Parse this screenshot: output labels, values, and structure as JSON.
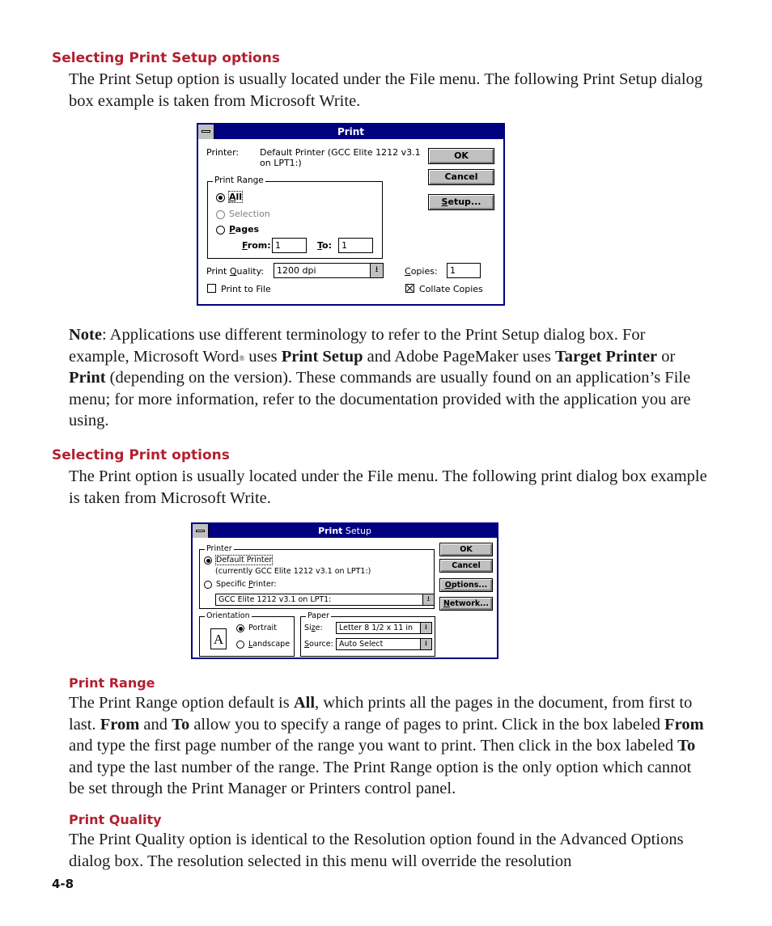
{
  "sections": {
    "print_setup_heading": "Selecting Print Setup options",
    "print_setup_intro": "The Print Setup option is usually located under the File menu. The following Print Setup dialog box example is taken from Microsoft Write.",
    "note": {
      "label": "Note",
      "text_1": ": Applications use different terminology to refer to the Print Setup dialog box. For example, Microsoft Word",
      "reg": "®",
      "text_2": " uses ",
      "bold_1": "Print Setup",
      "text_3": " and Adobe PageMaker uses ",
      "bold_2": "Target Printer",
      "text_4": " or ",
      "bold_3": "Print",
      "text_5": " (depending on the version). These commands are usually found on an application’s File menu; for more information, refer to the documentation provided with the application you are using."
    },
    "print_heading": "Selecting Print options",
    "print_intro": "The Print option is usually located under the File menu. The following print dialog box example is taken from Microsoft Write.",
    "print_range": {
      "heading": "Print Range",
      "t1": "The Print Range option default is ",
      "b1": "All",
      "t2": ", which prints all the pages in the document, from first to last. ",
      "b2": "From",
      "t3": " and ",
      "b3": "To",
      "t4": " allow you to specify a range of pages to print. Click in the box labeled ",
      "b4": "From",
      "t5": " and type the first page number of the range you want to print. Then click in the box labeled ",
      "b5": "To",
      "t6": " and type the last number of the range. The Print Range option is the only option which cannot be set through the Print Manager or Printers control panel."
    },
    "print_quality": {
      "heading": "Print Quality",
      "text": "The Print Quality option is identical to the Resolution option found in the Advanced Options dialog box. The resolution selected in this menu will override the resolution"
    }
  },
  "print_dialog": {
    "title": "Print",
    "printer_label": "Printer:",
    "printer_value_1": "Default Printer (GCC Elite 1212 v3.1",
    "printer_value_2": "on LPT1:)",
    "ok": "OK",
    "cancel": "Cancel",
    "setup_u": "S",
    "setup_rest": "etup...",
    "range_group": "Print Range",
    "all_u": "A",
    "all_rest": "ll",
    "selection": "Selection",
    "pages_u": "P",
    "pages_rest": "ages",
    "from_u": "F",
    "from_rest": "rom:",
    "from_value": "1",
    "to_u": "T",
    "to_rest": "o:",
    "to_value": "1",
    "quality_pre": "Print ",
    "quality_u": "Q",
    "quality_rest": "uality:",
    "quality_value": "1200 dpi",
    "copies_u": "C",
    "copies_rest": "opies:",
    "copies_value": "1",
    "print_to_file": "Print to File",
    "print_to_file_checked": false,
    "collate": "Collate Copies",
    "collate_checked": true,
    "range_selected": "All"
  },
  "print_setup_dialog": {
    "title_bold": "Print",
    "title_rest": " Setup",
    "printer_group": "Printer",
    "default_printer": "Default Printer",
    "currently": "(currently GCC Elite 1212 v3.1 on LPT1:)",
    "specific_pre": "Specific ",
    "specific_u": "P",
    "specific_rest": "rinter:",
    "specific_value": "GCC Elite 1212 v3.1 on LPT1:",
    "ok": "OK",
    "cancel": "Cancel",
    "options_u": "O",
    "options_rest": "ptions...",
    "network_u": "N",
    "network_rest": "etwork...",
    "orientation_group": "Orientation",
    "orientation_icon_letter": "A",
    "portrait": "Portrait",
    "landscape_u": "L",
    "landscape_rest": "andscape",
    "paper_group": "Paper",
    "size_pre": "Si",
    "size_u": "z",
    "size_rest": "e:",
    "size_value": "Letter 8 1/2 x 11 in",
    "source_u": "S",
    "source_rest": "ource:",
    "source_value": "Auto Select",
    "printer_selected": "Default Printer",
    "orientation_selected": "Portrait"
  },
  "page_number": "4-8"
}
